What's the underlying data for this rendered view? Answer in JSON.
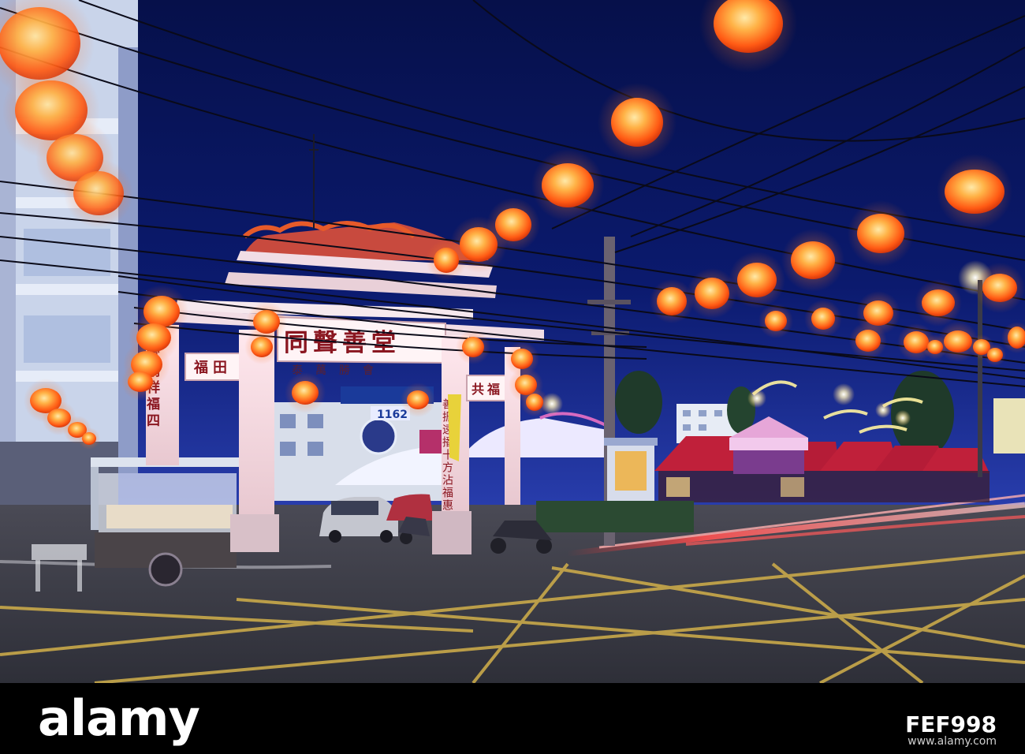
{
  "photo": {
    "subject": "Chinese shrine gate with red paper lanterns at night over a street intersection",
    "colors": {
      "sky": "#0b1a6e",
      "sky_horizon": "#2a3fb0",
      "lantern": "#ff6a1a",
      "lantern_glow": "#ffd27a",
      "road": "#3c3d48",
      "road_lines": "#c9a94a",
      "gate": "#f3e2e6",
      "tents": "#c0203a"
    }
  },
  "gate": {
    "top_sign": "同聲善堂",
    "sub_sign": "泰萬勝會",
    "left_plaque": "福田",
    "right_plaque": "共福",
    "blue_sign": "1162",
    "left_couplet": "堂納祥福四",
    "right_couplet": "善振遠播十方沾福惠"
  },
  "watermark": {
    "logo": "alamy",
    "image_id": "FEF998",
    "url": "www.alamy.com"
  }
}
